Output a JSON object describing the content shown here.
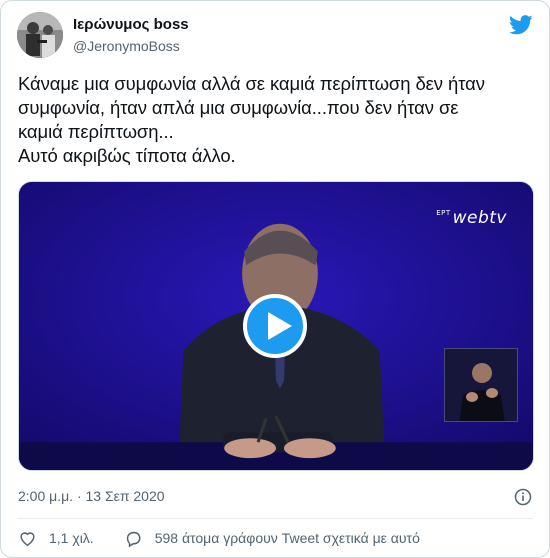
{
  "author": {
    "display_name": "Ιερώνυμος boss",
    "handle": "@JeronymoBoss"
  },
  "tweet": {
    "lines": [
      "Κάναμε μια συμφωνία αλλά σε καμιά περίπτωση δεν ήταν",
      "συμφωνία, ήταν απλά μια συμφωνία...που δεν ήταν σε",
      "καμιά περίπτωση...",
      "Αυτό ακριβώς τίποτα άλλο."
    ]
  },
  "media": {
    "logo_prefix": "ΕΡΤ",
    "logo_text": "webtv",
    "type": "video"
  },
  "meta": {
    "timestamp": "2:00 μ.μ. · 13 Σεπ 2020"
  },
  "actions": {
    "likes_count": "1,1 χιλ.",
    "discussion_text": "598 άτομα γράφουν Tweet σχετικά με αυτό"
  },
  "colors": {
    "accent": "#1d9bf0",
    "text": "#0f1419",
    "secondary": "#536471",
    "video_bg": "#1c0f8e"
  },
  "icons": [
    "twitter-bird-icon",
    "play-icon",
    "info-icon",
    "heart-icon",
    "speech-bubble-icon"
  ]
}
